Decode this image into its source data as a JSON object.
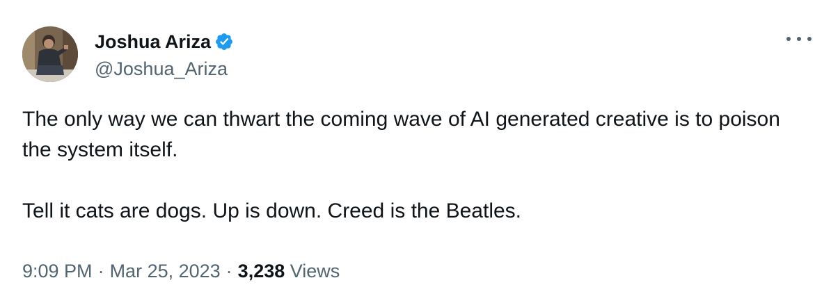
{
  "author": {
    "display_name": "Joshua Ariza",
    "handle": "@Joshua_Ariza",
    "verified": true,
    "avatar_icon": "user-avatar-photo"
  },
  "menu": {
    "icon": "more-horizontal-icon"
  },
  "tweet": {
    "lines": [
      "The only way we can thwart the coming wave of AI generated creative is to poison the system itself.",
      "Tell it cats are dogs. Up is down. Creed is the Beatles."
    ]
  },
  "meta": {
    "time": "9:09 PM",
    "separator": "·",
    "date": "Mar 25, 2023",
    "views_count": "3,238",
    "views_label": "Views"
  },
  "colors": {
    "text": "#0f1419",
    "secondary": "#536471",
    "verified": "#1d9bf0"
  }
}
